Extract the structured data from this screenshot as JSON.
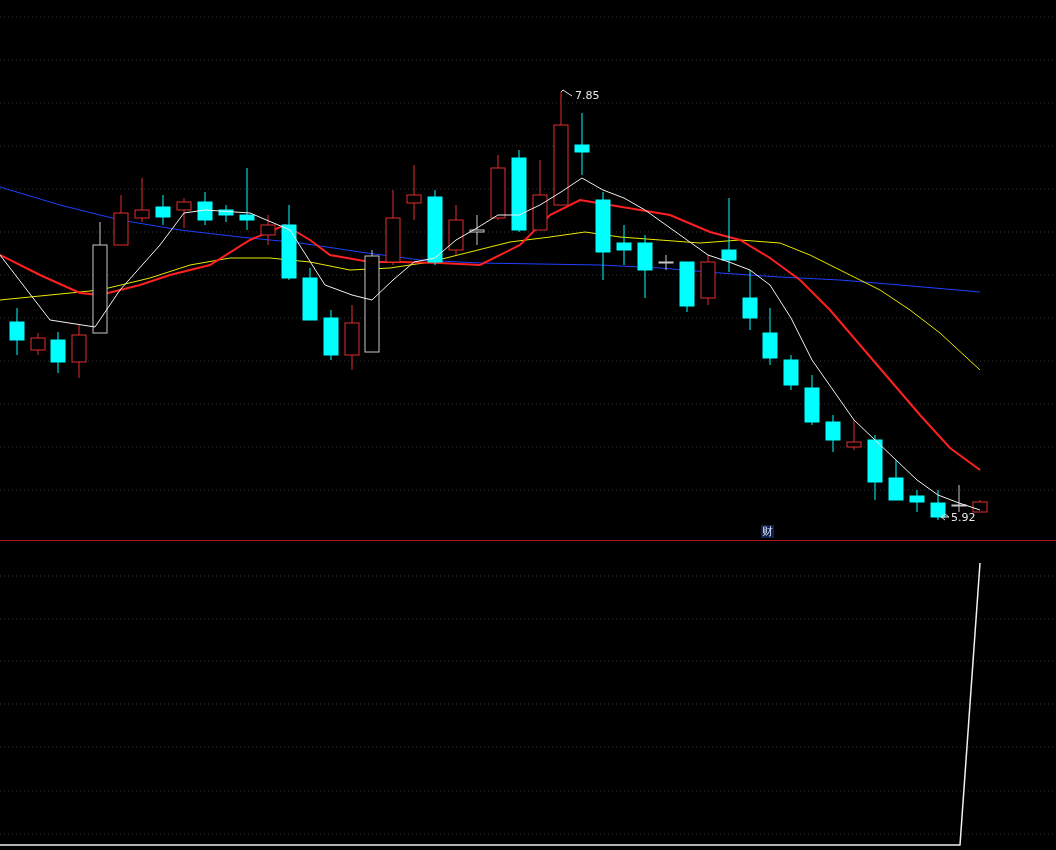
{
  "price_panel": {
    "high_label": "7.85",
    "low_label": "5.92",
    "marker": "财"
  }
}
